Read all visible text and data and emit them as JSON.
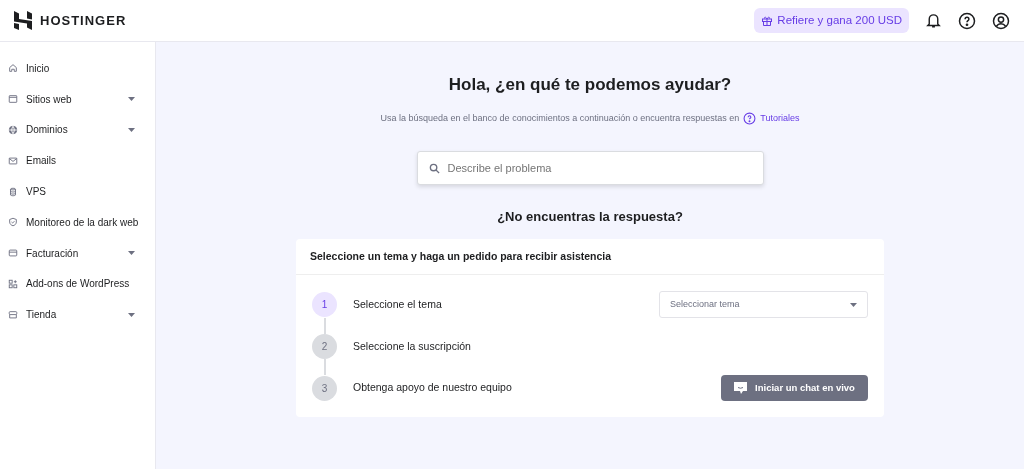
{
  "header": {
    "brand": "HOSTINGER",
    "referral": "Refiere y gana 200 USD"
  },
  "sidebar": {
    "items": [
      {
        "label": "Inicio",
        "has_submenu": false
      },
      {
        "label": "Sitios web",
        "has_submenu": true
      },
      {
        "label": "Dominios",
        "has_submenu": true
      },
      {
        "label": "Emails",
        "has_submenu": false
      },
      {
        "label": "VPS",
        "has_submenu": false
      },
      {
        "label": "Monitoreo de la dark web",
        "has_submenu": false
      },
      {
        "label": "Facturación",
        "has_submenu": true
      },
      {
        "label": "Add-ons de WordPress",
        "has_submenu": false
      },
      {
        "label": "Tienda",
        "has_submenu": true
      }
    ]
  },
  "main": {
    "title": "Hola, ¿en qué te podemos ayudar?",
    "subtitle": "Usa la búsqueda en el banco de conocimientos a continuación o encuentra respuestas en",
    "tutorials_link": "Tutoriales",
    "search": {
      "placeholder": "Describe el problema"
    },
    "no_answer": "¿No encuentras la respuesta?",
    "card": {
      "title": "Seleccione un tema y haga un pedido para recibir asistencia",
      "steps": [
        {
          "number": "1",
          "label": "Seleccione el tema",
          "selected": true
        },
        {
          "number": "2",
          "label": "Seleccione la suscripción",
          "selected": false
        },
        {
          "number": "3",
          "label": "Obtenga apoyo de nuestro equipo",
          "selected": false
        }
      ],
      "topic_select": {
        "placeholder": "Seleccionar tema"
      },
      "chat_button": {
        "label": "Iniciar un chat en vivo",
        "disabled": true
      }
    }
  }
}
